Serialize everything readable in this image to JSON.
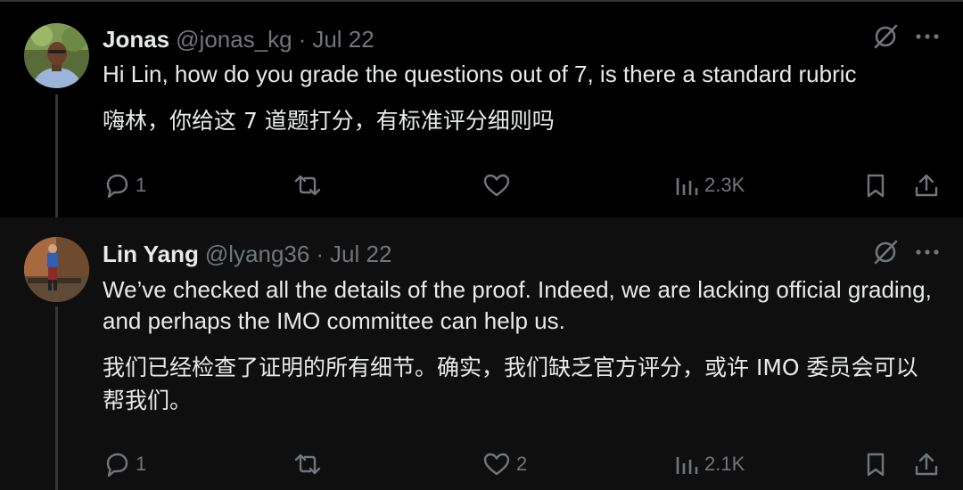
{
  "tweets": [
    {
      "name": "Jonas",
      "handle": "@jonas_kg",
      "separator": "·",
      "date": "Jul 22",
      "text_en": "Hi Lin,  how do you grade the questions out of 7, is there a standard rubric",
      "text_zh": "嗨林，你给这 7 道题打分，有标准评分细则吗",
      "replies": "1",
      "retweets": "",
      "likes": "",
      "views": "2.3K",
      "icons": [
        "grok-icon",
        "more-icon",
        "reply-icon",
        "retweet-icon",
        "like-icon",
        "views-icon",
        "bookmark-icon",
        "share-icon"
      ]
    },
    {
      "name": "Lin Yang",
      "handle": "@lyang36",
      "separator": "·",
      "date": "Jul 22",
      "text_en": "We’ve checked all the details of the proof. Indeed, we are lacking official grading, and perhaps the IMO committee can help us.",
      "text_zh": "我们已经检查了证明的所有细节。确实，我们缺乏官方评分，或许 IMO 委员会可以帮我们。",
      "replies": "1",
      "retweets": "",
      "likes": "2",
      "views": "2.1K",
      "icons": [
        "grok-icon",
        "more-icon",
        "reply-icon",
        "retweet-icon",
        "like-icon",
        "views-icon",
        "bookmark-icon",
        "share-icon"
      ]
    }
  ],
  "colors": {
    "background": "#000000",
    "background_reply": "#0f0f0f",
    "text": "#e7e9ea",
    "muted": "#71767b",
    "thread_line": "#333639"
  }
}
